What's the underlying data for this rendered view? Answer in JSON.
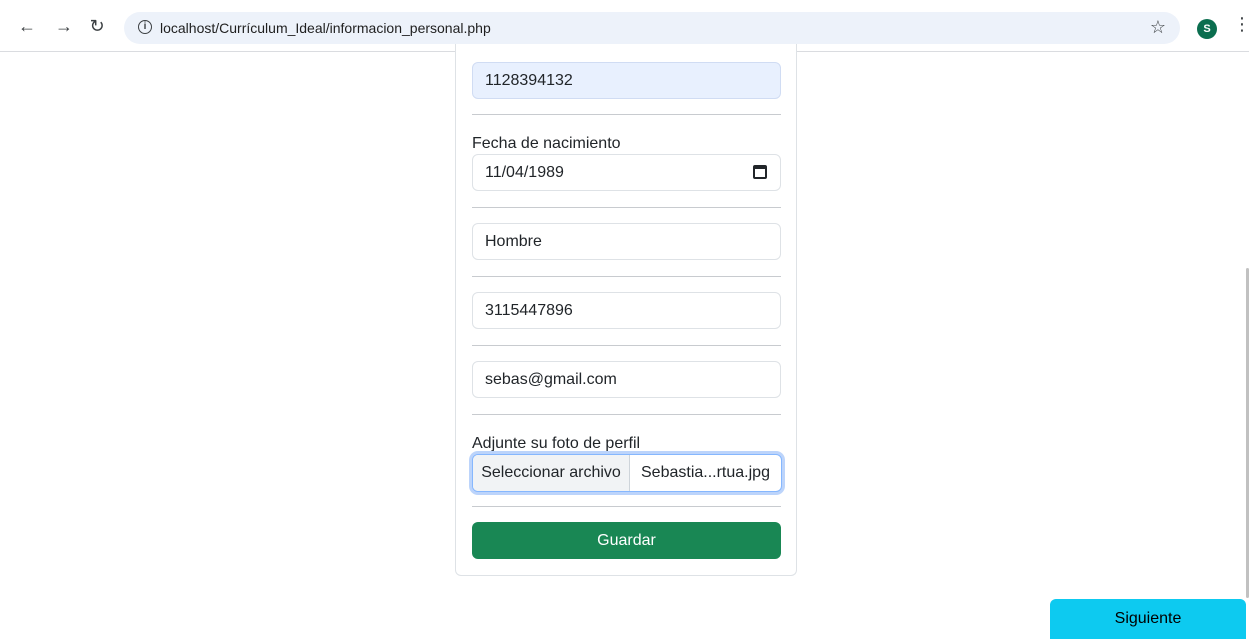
{
  "browser": {
    "url": "localhost/Currículum_Ideal/informacion_personal.php",
    "avatar_initial": "S"
  },
  "form": {
    "id_number": "1128394132",
    "birth_date_label": "Fecha de nacimiento",
    "birth_date_value": "11/04/1989",
    "gender": "Hombre",
    "phone": "3115447896",
    "email": "sebas@gmail.com",
    "photo_label": "Adjunte su foto de perfil",
    "file_button": "Seleccionar archivo",
    "file_name": "Sebastia...rtua.jpg",
    "save_button": "Guardar"
  },
  "next_button": "Siguiente"
}
